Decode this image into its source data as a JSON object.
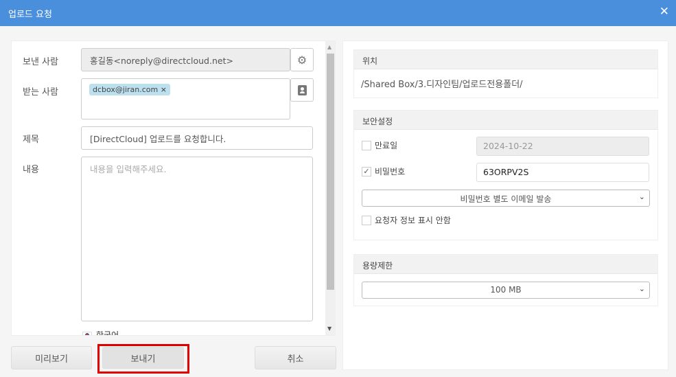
{
  "dialog": {
    "title": "업로드 요청",
    "close_icon": "close-icon"
  },
  "form": {
    "from_label": "보낸 사람",
    "from_value": "홍길동<noreply@directcloud.net>",
    "to_label": "받는 사람",
    "recipients": [
      "dcbox@jiran.com"
    ],
    "subject_label": "제목",
    "subject_value": "[DirectCloud] 업로드를 요청합니다.",
    "content_label": "내용",
    "content_placeholder": "내용을 입력해주세요.",
    "language": "한국어"
  },
  "buttons": {
    "preview": "미리보기",
    "send": "보내기",
    "cancel": "취소"
  },
  "location": {
    "header": "위치",
    "path": "/Shared Box/3.디자인팀/업로드전용폴더/"
  },
  "security": {
    "header": "보안설정",
    "expiry_label": "만료일",
    "expiry_checked": false,
    "expiry_value": "2024-10-22",
    "password_label": "비밀번호",
    "password_checked": true,
    "password_value": "63ORPV2S",
    "password_delivery": "비밀번호 별도 이메일 발송",
    "hide_requester_label": "요청자 정보 표시 안함",
    "hide_requester_checked": false
  },
  "capacity": {
    "header": "용량제한",
    "value": "100 MB"
  },
  "colors": {
    "titlebar": "#4a8fdc",
    "highlight": "#e00000"
  }
}
